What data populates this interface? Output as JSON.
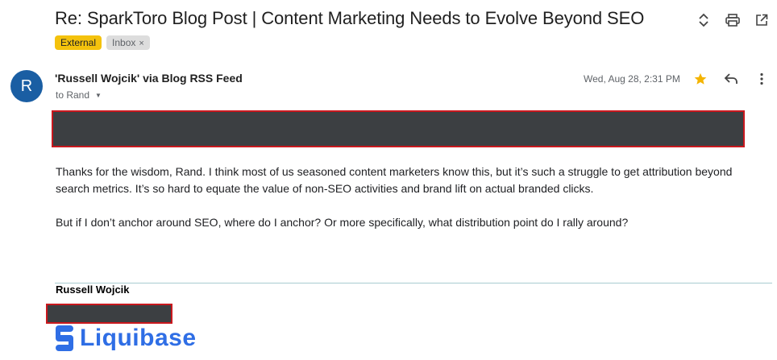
{
  "email": {
    "subject": "Re: SparkToro Blog Post | Content Marketing Needs to Evolve Beyond SEO",
    "labels": {
      "external": "External",
      "inbox": "Inbox",
      "inbox_remove": "×"
    },
    "sender": {
      "avatar_letter": "R",
      "name": "'Russell Wojcik' via Blog RSS Feed",
      "to_text": "to Rand"
    },
    "date": "Wed, Aug 28, 2:31 PM",
    "body": {
      "p1": "Thanks for the wisdom, Rand. I think most of us seasoned content marketers know this, but it’s such a struggle to get attribution beyond search metrics. It’s so hard to equate the value of non-SEO activities and brand lift on actual branded clicks.",
      "p2": "But if I don’t anchor around SEO, where do I anchor? Or more specifically, what distribution point do I rally around?"
    },
    "signature": {
      "name": "Russell Wojcik",
      "logo_text": "Liquibase"
    }
  },
  "colors": {
    "accent_star": "#f4b400",
    "external_chip": "#f4c20d",
    "avatar": "#1a5ea3",
    "logo_blue": "#2f6ee5",
    "redaction_border": "#c9181e"
  },
  "icons": [
    "expand-collapse-icon",
    "print-icon",
    "open-new-window-icon",
    "star-icon",
    "reply-icon",
    "more-vert-icon",
    "dropdown-caret-icon"
  ]
}
